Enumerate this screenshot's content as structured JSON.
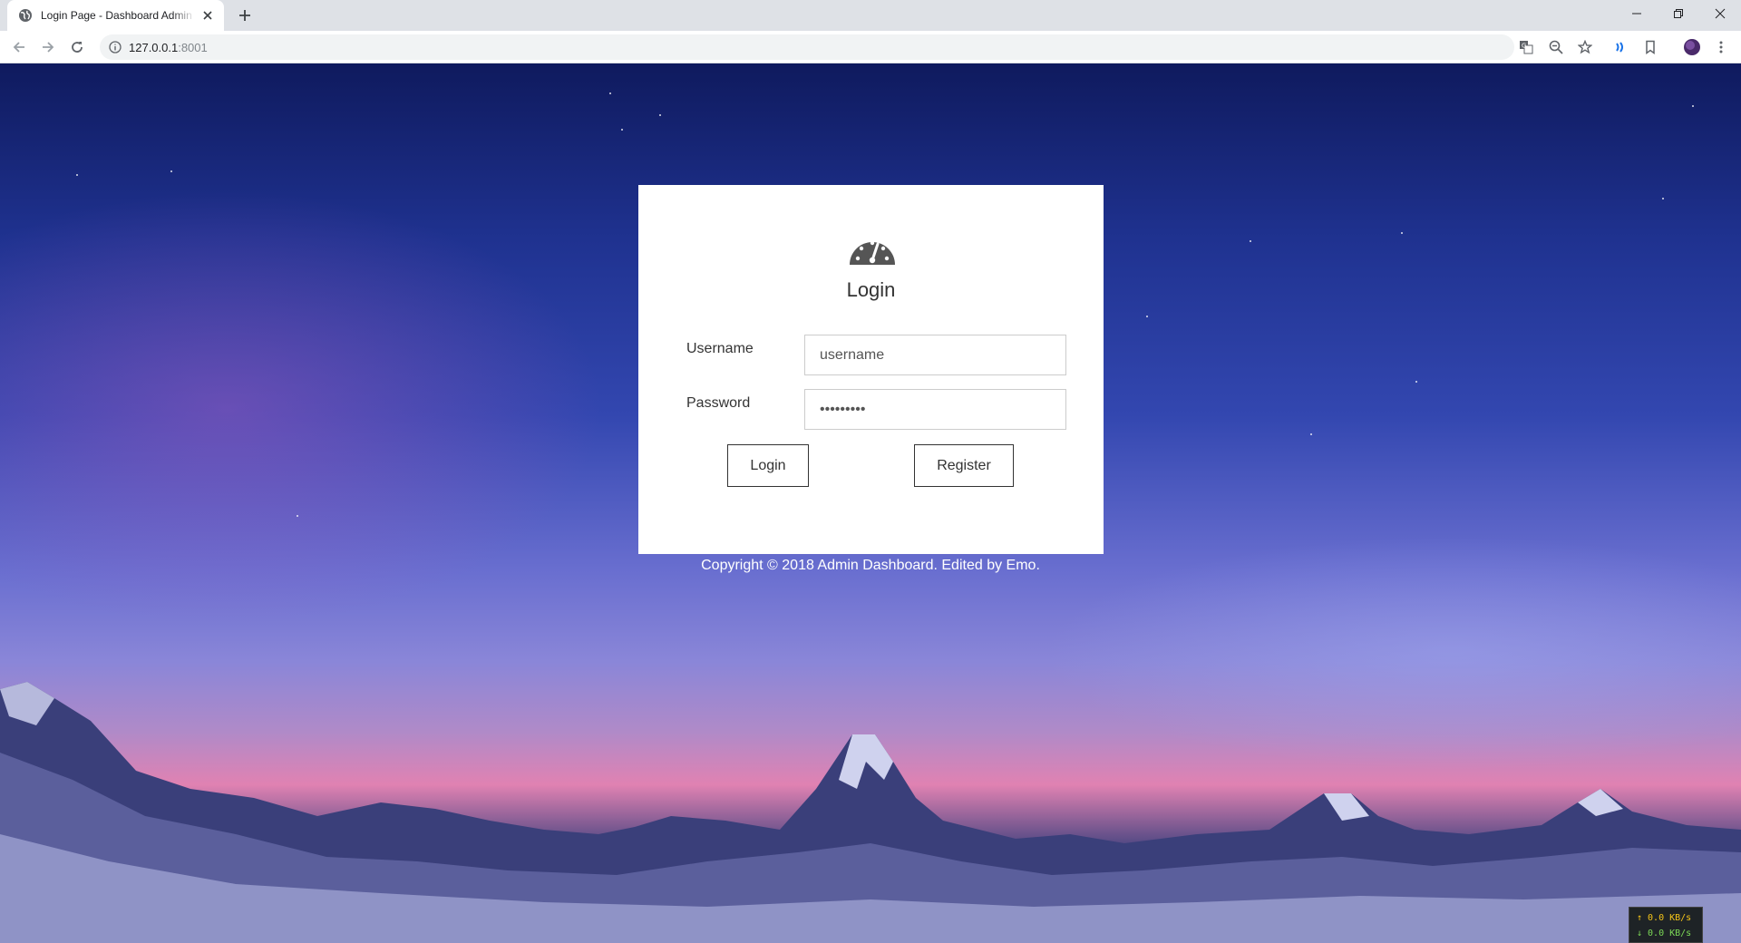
{
  "browser": {
    "tab_title": "Login Page - Dashboard Admin Template",
    "url_host": "127.0.0.1",
    "url_port": ":8001"
  },
  "login": {
    "title": "Login",
    "username_label": "Username",
    "username_placeholder": "username",
    "password_label": "Password",
    "password_value": "password1",
    "login_button": "Login",
    "register_button": "Register"
  },
  "footer": {
    "copyright": "Copyright © 2018 Admin Dashboard. Edited by Emo."
  },
  "netspeed": {
    "upload": "↑ 0.0 KB/s",
    "download": "↓ 0.0 KB/s"
  },
  "colors": {
    "card_background": "#ffffff",
    "text_dark": "#333333",
    "sky_top": "#0f1a5e",
    "sky_pink": "#e082b2"
  },
  "icons": {
    "tab_favicon": "globe-icon",
    "card_logo": "dashboard-gauge-icon"
  }
}
